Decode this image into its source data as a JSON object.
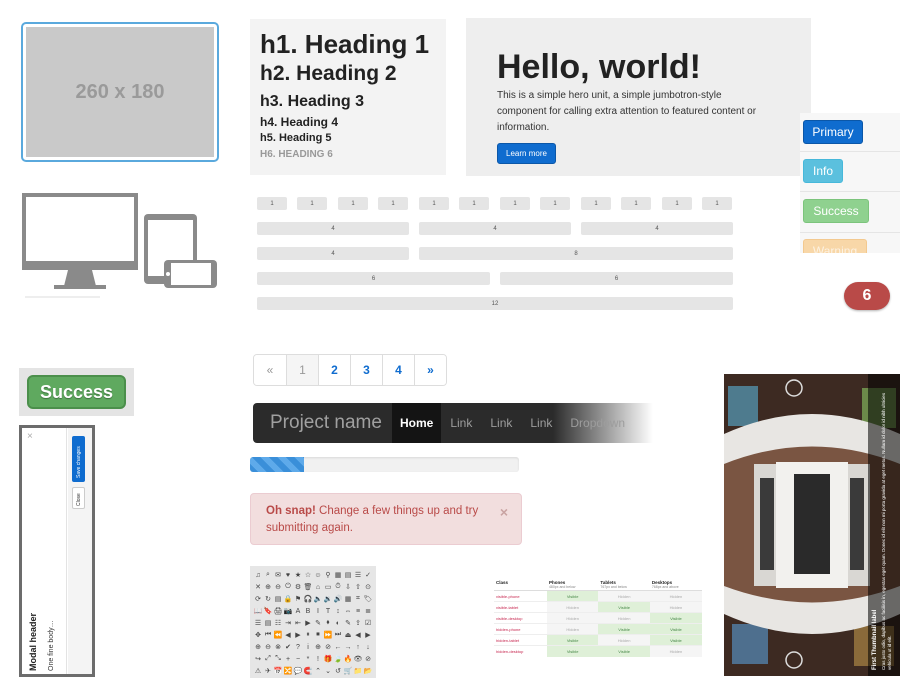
{
  "placeholder": {
    "label": "260 x 180"
  },
  "headings": {
    "h1": "h1. Heading 1",
    "h2": "h2. Heading 2",
    "h3": "h3. Heading 3",
    "h4": "h4. Heading 4",
    "h5": "h5. Heading 5",
    "h6": "H6. HEADING 6"
  },
  "hero": {
    "title": "Hello, world!",
    "text": "This is a simple hero unit, a simple jumbotron-style component for calling extra attention to featured content or information.",
    "button": "Learn more"
  },
  "buttons": {
    "primary": "Primary",
    "info": "Info",
    "success": "Success",
    "warning": "Warning",
    "colors": {
      "primary": "#0f6ccf",
      "info": "#5bc0de",
      "success": "#8fd18f",
      "warning": "#f8d7a8"
    }
  },
  "badge": {
    "value": "6",
    "color": "#b94a48"
  },
  "grid": {
    "row1": [
      "1",
      "1",
      "1",
      "1",
      "1",
      "1",
      "1",
      "1",
      "1",
      "1",
      "1",
      "1"
    ],
    "row2": [
      "4",
      "4",
      "4"
    ],
    "row3": [
      "4",
      "8"
    ],
    "row4": [
      "6",
      "6"
    ],
    "row5": [
      "12"
    ]
  },
  "success_label": {
    "text": "Success"
  },
  "modal": {
    "close": "×",
    "header": "Modal header",
    "body": "One fine body…",
    "save": "Save changes",
    "close_btn": "Close"
  },
  "pagination": {
    "prev": "«",
    "pages": [
      "1",
      "2",
      "3",
      "4"
    ],
    "next": "»",
    "active": "1"
  },
  "navbar": {
    "brand": "Project name",
    "items": [
      "Home",
      "Link",
      "Link",
      "Link",
      "Dropdown"
    ]
  },
  "progress": {
    "percent": 20
  },
  "alert": {
    "strong": "Oh snap!",
    "text": " Change a few things up and try submitting again.",
    "close": "×"
  },
  "glyphs": [
    "♫",
    "⌕",
    "✉",
    "♥",
    "★",
    "☆",
    "☺",
    "⚲",
    "▦",
    "▤",
    "☰",
    "✓",
    "✕",
    "⊕",
    "⊖",
    "⏻",
    "⚙",
    "🗑",
    "⌂",
    "▭",
    "⏱",
    "⇩",
    "⇧",
    "⊙",
    "⟳",
    "↻",
    "▤",
    "🔒",
    "⚑",
    "🎧",
    "🔈",
    "🔉",
    "🔊",
    "▦",
    "⌗",
    "🏷",
    "📖",
    "🔖",
    "🖨",
    "📷",
    "A",
    "B",
    "I",
    "T",
    "↕",
    "⇔",
    "≡",
    "≣",
    "☰",
    "▤",
    "☷",
    "⇥",
    "⇤",
    "▶",
    "✎",
    "⬧",
    "◐",
    "✎",
    "⇪",
    "☑",
    "✥",
    "⏮",
    "⏪",
    "◀",
    "▶",
    "⏸",
    "⏹",
    "⏩",
    "⏭",
    "⏏",
    "◀",
    "▶",
    "⊕",
    "⊖",
    "⊗",
    "✔",
    "?",
    "i",
    "⊕",
    "⊘",
    "←",
    "→",
    "↑",
    "↓",
    "↪",
    "⤢",
    "⤡",
    "+",
    "−",
    "*",
    "!",
    "🎁",
    "🍃",
    "🔥",
    "👁",
    "⊘",
    "⚠",
    "✈",
    "📅",
    "🔀",
    "💬",
    "🧲",
    "⌃",
    "⌄",
    "↺",
    "🛒",
    "📁",
    "📂",
    "↕",
    "↔",
    "📊",
    "🐦",
    "f",
    "📷",
    "🔑",
    "⚙",
    "💬",
    "👍"
  ],
  "table": {
    "headers": [
      {
        "title": "Class",
        "sub": ""
      },
      {
        "title": "Phones",
        "sub": "480px and below"
      },
      {
        "title": "Tablets",
        "sub": "767px and below"
      },
      {
        "title": "Desktops",
        "sub": "768px and above"
      }
    ],
    "rows": [
      [
        "visible-phone",
        "Visible",
        "Hidden",
        "Hidden"
      ],
      [
        "visible-tablet",
        "Hidden",
        "Visible",
        "Hidden"
      ],
      [
        "visible-desktop",
        "Hidden",
        "Hidden",
        "Visible"
      ],
      [
        "hidden-phone",
        "Hidden",
        "Visible",
        "Visible"
      ],
      [
        "hidden-tablet",
        "Visible",
        "Hidden",
        "Visible"
      ],
      [
        "hidden-desktop",
        "Visible",
        "Visible",
        "Hidden"
      ]
    ]
  },
  "thumbnail": {
    "label": "First Thumbnail label",
    "caption": "Cras justo odio, dapibus ac facilisis in, egestas eget quam. Donec id elit non mi porta gravida at eget metus. Nullam id dolor id nibh ultricies vehicula ut id elit."
  }
}
